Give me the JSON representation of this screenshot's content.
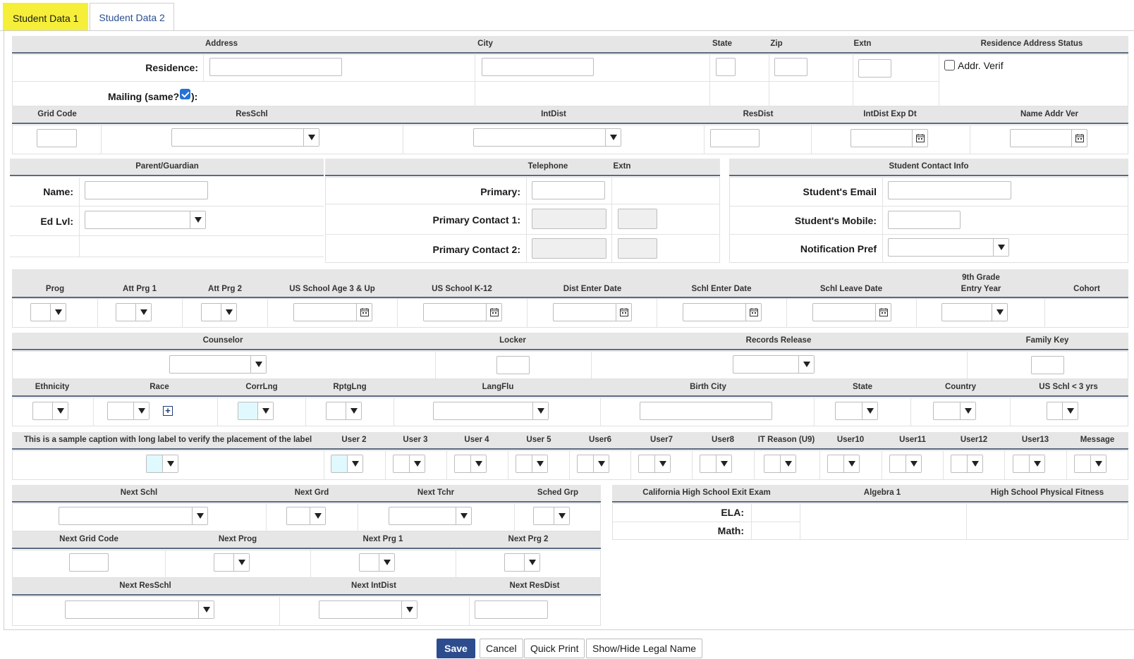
{
  "tabs": [
    "Student Data 1",
    "Student Data 2"
  ],
  "address": {
    "headers": {
      "address": "Address",
      "city": "City",
      "state": "State",
      "zip": "Zip",
      "extn": "Extn",
      "status": "Residence Address Status"
    },
    "residence_label": "Residence:",
    "mailing_label_a": "Mailing (same?",
    "mailing_label_b": "):",
    "addr_verif": "Addr. Verif",
    "row2_headers": {
      "grid_code": "Grid Code",
      "resschl": "ResSchl",
      "intdist": "IntDist",
      "resdist": "ResDist",
      "intdist_exp": "IntDist Exp Dt",
      "name_addr_ver": "Name Addr Ver"
    }
  },
  "parent": {
    "header": "Parent/Guardian",
    "name_label": "Name:",
    "edlvl_label": "Ed Lvl:"
  },
  "telephone": {
    "header": "Telephone",
    "extn": "Extn",
    "primary": "Primary:",
    "contact1": "Primary Contact 1:",
    "contact2": "Primary Contact 2:"
  },
  "contact": {
    "header": "Student Contact Info",
    "email": "Student's Email",
    "mobile": "Student's Mobile:",
    "notif": "Notification Pref"
  },
  "programs": {
    "prog": "Prog",
    "att1": "Att Prg 1",
    "att2": "Att Prg 2",
    "us3": "US School Age 3 & Up",
    "usk12": "US School K-12",
    "dist_enter": "Dist Enter Date",
    "schl_enter": "Schl Enter Date",
    "schl_leave": "Schl Leave Date",
    "ninth_a": "9th Grade",
    "ninth_b": "Entry Year",
    "cohort": "Cohort"
  },
  "misc": {
    "counselor": "Counselor",
    "locker": "Locker",
    "records": "Records Release",
    "family": "Family Key",
    "ethnicity": "Ethnicity",
    "race": "Race",
    "corrlng": "CorrLng",
    "rptglng": "RptgLng",
    "langflu": "LangFlu",
    "birth_city": "Birth City",
    "state": "State",
    "country": "Country",
    "us_schl": "US Schl < 3 yrs",
    "race_add": "+"
  },
  "users": {
    "caption": "This is a sample caption with long label to verify the placement of the label",
    "labels": [
      "User 2",
      "User 3",
      "User 4",
      "User 5",
      "User6",
      "User7",
      "User8",
      "IT Reason (U9)",
      "User10",
      "User11",
      "User12",
      "User13",
      "Message"
    ]
  },
  "next": {
    "next_schl": "Next Schl",
    "next_grd": "Next Grd",
    "next_tchr": "Next Tchr",
    "sched_grp": "Sched Grp",
    "next_grid": "Next Grid Code",
    "next_prog": "Next Prog",
    "next_prg1": "Next Prg 1",
    "next_prg2": "Next Prg 2",
    "next_resschl": "Next ResSchl",
    "next_intdist": "Next IntDist",
    "next_resdist": "Next ResDist"
  },
  "exams": {
    "cahsee": "California High School Exit Exam",
    "algebra": "Algebra 1",
    "fitness": "High School Physical Fitness",
    "ela": "ELA:",
    "math": "Math:"
  },
  "buttons": {
    "save": "Save",
    "cancel": "Cancel",
    "quick_print": "Quick Print",
    "legal_name": "Show/Hide Legal Name"
  },
  "colors": {
    "tab_active": "#f5ef3a",
    "primary_button": "#2c4c8e",
    "header_band": "#e6e6e6",
    "checkbox_on": "#2472d6",
    "cyan_field": "#e0f9ff"
  }
}
